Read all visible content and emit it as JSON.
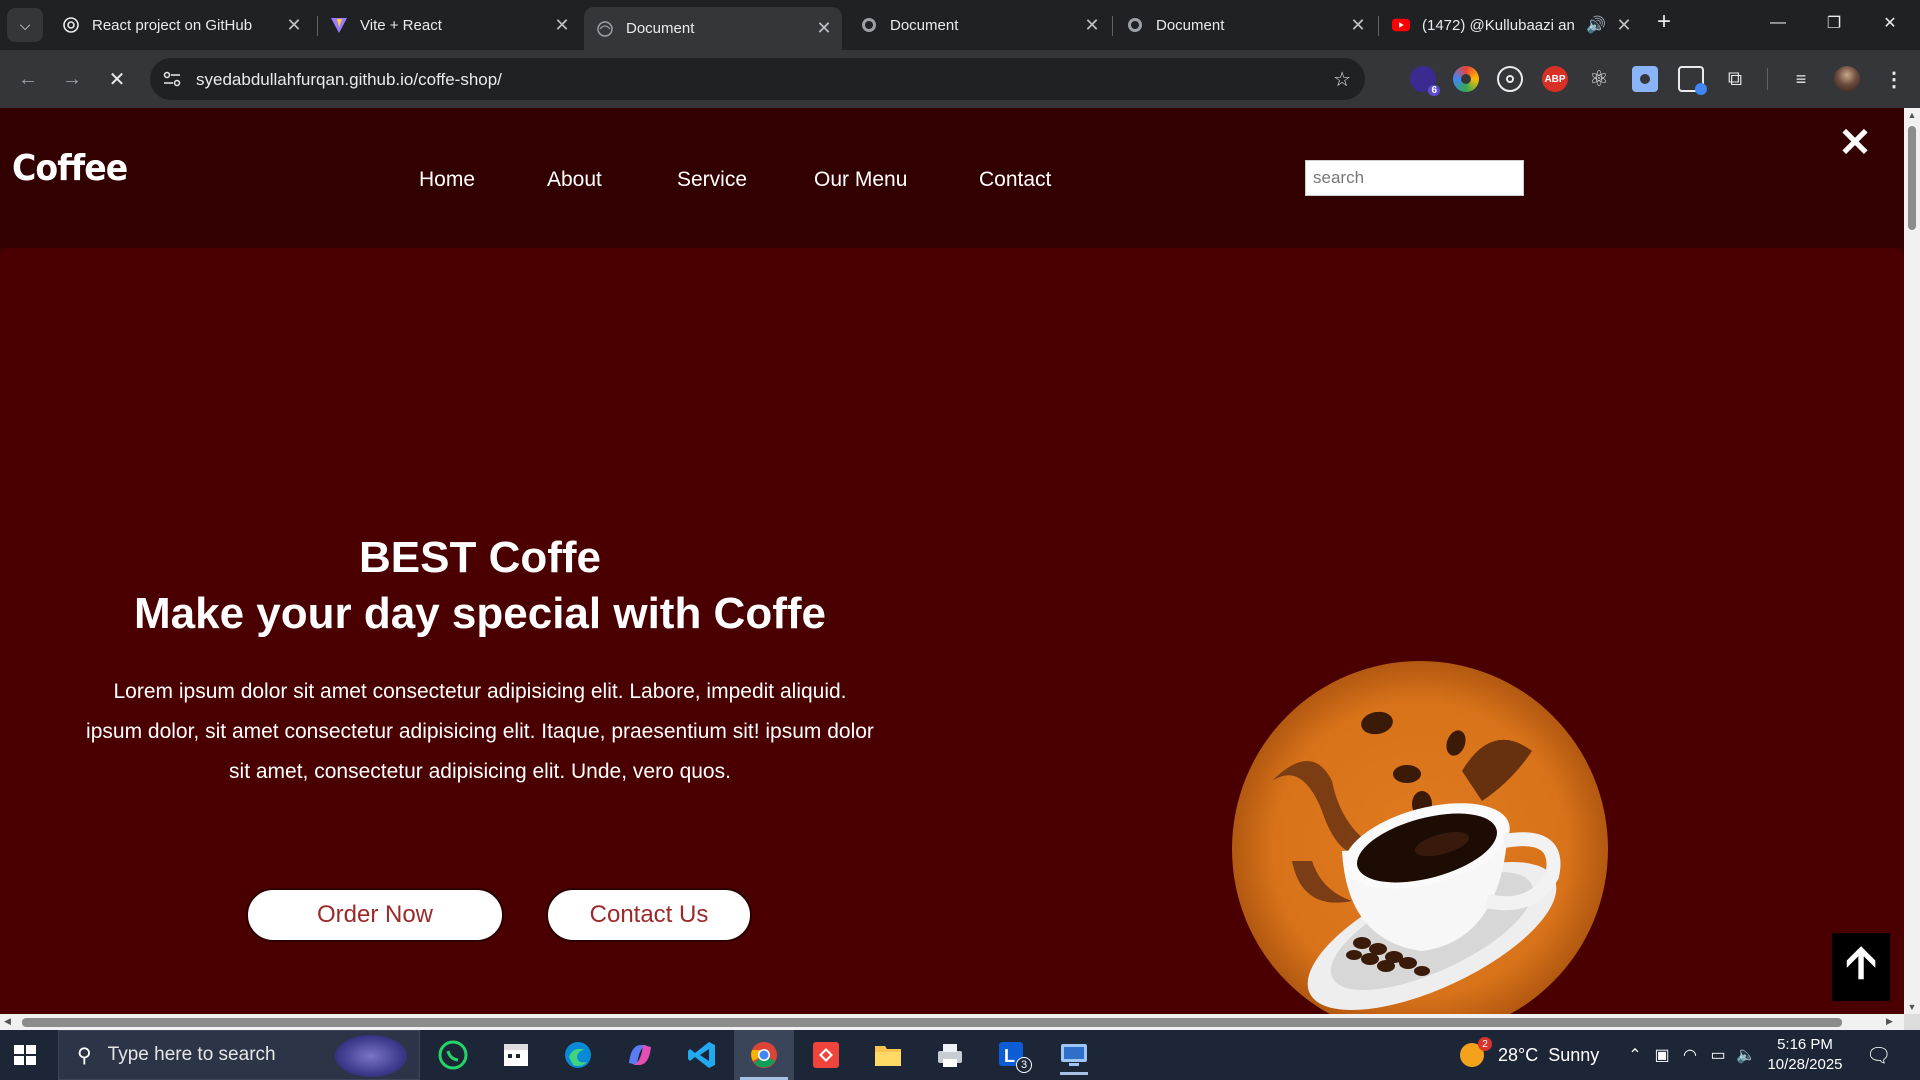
{
  "browser": {
    "tabs": [
      {
        "title": "React project on GitHub",
        "icon": "openai-icon",
        "active": false
      },
      {
        "title": "Vite + React",
        "icon": "vite-icon",
        "active": false
      },
      {
        "title": "Document",
        "icon": "globe-icon",
        "active": true
      },
      {
        "title": "Document",
        "icon": "globe-icon",
        "active": false
      },
      {
        "title": "Document",
        "icon": "globe-icon",
        "active": false
      },
      {
        "title": "(1472) @Kullubaazi an",
        "icon": "youtube-icon",
        "active": false
      }
    ],
    "url": "syedabdullahfurqan.github.io/coffe-shop/",
    "extensions": [
      {
        "name": "extension-badge",
        "badge": "6"
      },
      {
        "name": "color-picker"
      },
      {
        "name": "target"
      },
      {
        "name": "adblock",
        "label": "ABP"
      },
      {
        "name": "react-devtools"
      },
      {
        "name": "screen-capture"
      },
      {
        "name": "tab-manager"
      },
      {
        "name": "extensions-puzzle"
      },
      {
        "name": "media-control"
      },
      {
        "name": "profile-avatar"
      }
    ]
  },
  "page": {
    "logo": "Coffee",
    "nav": [
      "Home",
      "About",
      "Service",
      "Our Menu",
      "Contact"
    ],
    "search_placeholder": "search",
    "hero": {
      "title": "BEST Coffe",
      "subtitle": "Make your day special with Coffe",
      "text_lines": [
        "Lorem ipsum dolor sit amet consectetur adipisicing elit. Labore, impedit aliquid.",
        "ipsum dolor, sit amet consectetur adipisicing elit. Itaque, praesentium sit! ipsum dolor",
        "sit amet, consectetur adipisicing elit. Unde, vero quos."
      ],
      "order_button": "Order Now",
      "contact_button": "Contact Us"
    },
    "colors": {
      "navbar": "#330000",
      "hero": "#4a0000",
      "button_text": "#9c2a2a",
      "image_bg": "#d9731a"
    }
  },
  "taskbar": {
    "search_placeholder": "Type here to search",
    "apps": [
      "whatsapp-icon",
      "clapper-icon",
      "edge-icon",
      "copilot-icon",
      "vscode-icon",
      "chrome-icon",
      "anydesk-icon",
      "file-explorer-icon",
      "printer-icon",
      "lens-icon",
      "remote-desktop-icon"
    ],
    "weather": {
      "temp": "28°C",
      "condition": "Sunny",
      "badge": "2"
    },
    "lens_badge": "3",
    "time": "5:16 PM",
    "date": "10/28/2025"
  }
}
